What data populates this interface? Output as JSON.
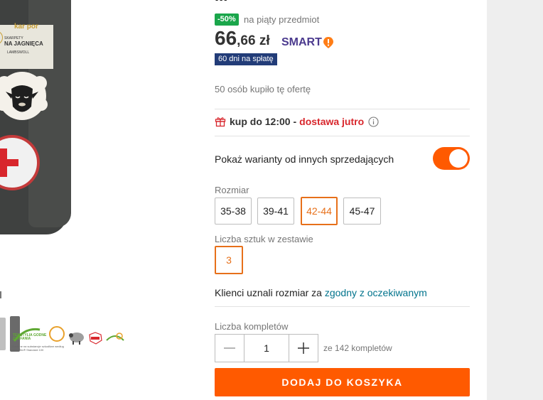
{
  "product_image": {
    "brand": "kar por",
    "label_line1": "SKARPETY",
    "label_line2": "NA JAGNIĘCA",
    "label_line3": "LAMBSWOLL",
    "badge_title": "TEKSTYLIA GODNE ZAUFANIA",
    "badge_sub": "Zbadane na substancje szkodliwe według Oeko-Tex® Standard 100"
  },
  "header_partial": "...",
  "discount": {
    "badge": "-50%",
    "text": "na piąty przedmiot"
  },
  "price": {
    "integer": "66",
    "decimal": ",66 zł",
    "smart_label": "SMART",
    "installments_badge": "60 dni na spłatę"
  },
  "bought_count": "50 osób kupiło tę ofertę",
  "delivery": {
    "prefix": "kup do 12:00 -",
    "highlight": "dostawa jutro",
    "info_icon": "info-icon"
  },
  "other_sellers": {
    "label": "Pokaż warianty od innych sprzedających",
    "enabled": true
  },
  "size": {
    "label": "Rozmiar",
    "options": [
      "35-38",
      "39-41",
      "42-44",
      "45-47"
    ],
    "selected": "42-44"
  },
  "set_count": {
    "label": "Liczba sztuk w zestawie",
    "options": [
      "3"
    ],
    "selected": "3"
  },
  "fit": {
    "prefix": "Klienci uznali rozmiar za",
    "link": "zgodny z oczekiwanym"
  },
  "quantity": {
    "label": "Liczba kompletów",
    "value": "1",
    "available": "ze 142 kompletów"
  },
  "add_to_cart": "DODAJ DO KOSZYKA",
  "colors": {
    "accent": "#ff5a00",
    "discount_green": "#1aa64b",
    "link_teal": "#00738c",
    "delivery_red": "#d8262c",
    "navy": "#223c78",
    "smart_purple": "#4b3a8e"
  }
}
